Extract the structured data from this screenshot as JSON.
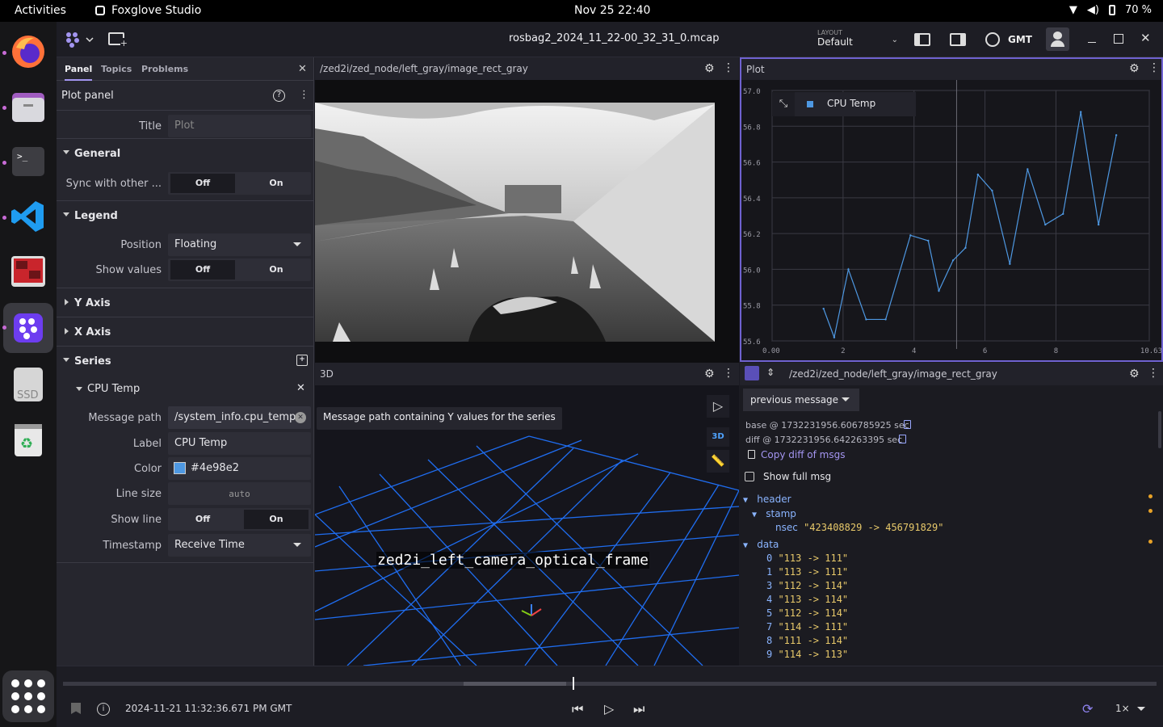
{
  "system": {
    "activities": "Activities",
    "app_name": "Foxglove Studio",
    "clock": "Nov 25  22:40",
    "battery": "70 %"
  },
  "header": {
    "file": "rosbag2_2024_11_22-00_32_31_0.mcap",
    "layout_caption": "LAYOUT",
    "layout_name": "Default",
    "timezone": "GMT"
  },
  "left_panel": {
    "tabs": [
      "Panel",
      "Topics",
      "Problems"
    ],
    "panel_title": "Plot panel",
    "title_label": "Title",
    "title_placeholder": "Plot",
    "general": "General",
    "sync_label": "Sync with other ...",
    "off": "Off",
    "on": "On",
    "legend": "Legend",
    "position_label": "Position",
    "position_value": "Floating",
    "show_values_label": "Show values",
    "y_axis": "Y Axis",
    "x_axis": "X Axis",
    "series": "Series",
    "series_name": "CPU Temp",
    "message_path_label": "Message path",
    "message_path_value": "/system_info.cpu_temp",
    "label_label": "Label",
    "label_value": "CPU Temp",
    "color_label": "Color",
    "color_value": "#4e98e2",
    "line_size_label": "Line size",
    "line_size_placeholder": "auto",
    "show_line_label": "Show line",
    "timestamp_label": "Timestamp",
    "timestamp_value": "Receive Time",
    "tooltip": "Message path containing Y values for the series"
  },
  "image_panel": {
    "title": "/zed2i/zed_node/left_gray/image_rect_gray"
  },
  "plot_panel": {
    "title": "Plot",
    "legend_entry": "CPU Temp"
  },
  "three_d_panel": {
    "title": "3D",
    "mode_badge": "3D",
    "frame_label": "zed2i_left_camera_optical_frame"
  },
  "diff_panel": {
    "topic": "/zed2i/zed_node/left_gray/image_rect_gray",
    "mode": "previous message",
    "base": "base @ 1732231956.606785925 sec",
    "diff": "diff @ 1732231956.642263395 sec",
    "copy_diff": "Copy diff of msgs",
    "show_full": "Show full msg",
    "header_key": "header",
    "stamp_key": "stamp",
    "nsec_key": "nsec",
    "nsec_val": "\"423408829 -> 456791829\"",
    "data_key": "data",
    "data_rows": [
      {
        "i": "0",
        "v": "\"113 -> 111\""
      },
      {
        "i": "1",
        "v": "\"113 -> 111\""
      },
      {
        "i": "3",
        "v": "\"112 -> 114\""
      },
      {
        "i": "4",
        "v": "\"113 -> 114\""
      },
      {
        "i": "5",
        "v": "\"112 -> 114\""
      },
      {
        "i": "7",
        "v": "\"114 -> 111\""
      },
      {
        "i": "8",
        "v": "\"111 -> 114\""
      },
      {
        "i": "9",
        "v": "\"114 -> 113\""
      }
    ]
  },
  "playback": {
    "time": "2024-11-21 11:32:36.671 PM GMT",
    "speed": "1×",
    "progress": 0.46
  },
  "chart_data": {
    "type": "line",
    "series": [
      {
        "name": "CPU Temp",
        "color": "#4e98e2",
        "x": [
          1.45,
          1.75,
          2.15,
          2.65,
          3.2,
          3.9,
          4.4,
          4.7,
          5.1,
          5.45,
          5.8,
          6.2,
          6.7,
          7.2,
          7.7,
          8.2,
          8.7,
          9.2,
          9.7
        ],
        "y": [
          55.78,
          55.62,
          56.0,
          55.72,
          55.72,
          56.19,
          56.16,
          55.88,
          56.05,
          56.12,
          56.53,
          56.44,
          56.03,
          56.56,
          56.25,
          56.31,
          56.88,
          56.25,
          56.75
        ]
      }
    ],
    "xlim": [
      0.0,
      10.63
    ],
    "ylim": [
      55.6,
      57.0
    ],
    "x_ticks": [
      "0.00",
      "2",
      "4",
      "6",
      "8",
      "10.63"
    ],
    "y_ticks": [
      "57.0",
      "56.8",
      "56.6",
      "56.4",
      "56.2",
      "56.0",
      "55.8",
      "55.6"
    ],
    "grid": true,
    "legend": "top-left"
  }
}
